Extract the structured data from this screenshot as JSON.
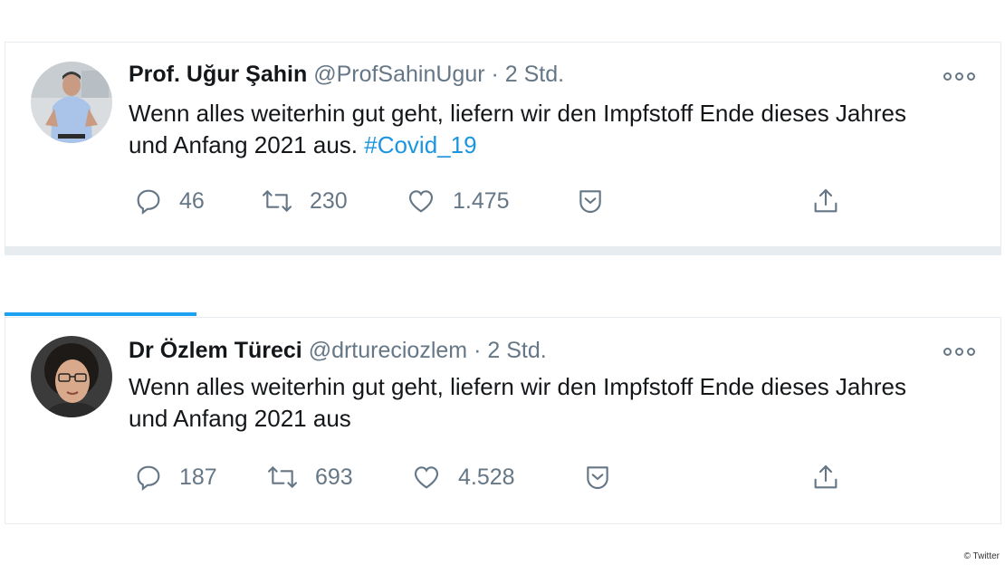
{
  "tweets": [
    {
      "name": "Prof. Uğur Şahin",
      "handle": "@ProfSahinUgur",
      "dot": "·",
      "time": "2 Std.",
      "text": "Wenn alles weiterhin gut geht, liefern wir den Impfstoff Ende dieses Jahres und Anfang 2021 aus. ",
      "hashtag": "#Covid_19",
      "replies": "46",
      "retweets": "230",
      "likes": "1.475"
    },
    {
      "name": "Dr Özlem Türeci",
      "handle": "@drtureciozlem",
      "dot": "·",
      "time": "2 Std.",
      "text": "Wenn alles weiterhin gut geht, liefern wir den Impfstoff Ende dieses Jahres und Anfang 2021 aus",
      "hashtag": "",
      "replies": "187",
      "retweets": "693",
      "likes": "4.528"
    }
  ],
  "credit": "© Twitter",
  "colors": {
    "accent": "#1da1f2",
    "hashtag": "#1b95e0",
    "muted": "#657786",
    "border": "#e6ecf0"
  },
  "icons": [
    "avatar",
    "more-icon",
    "reply-icon",
    "retweet-icon",
    "like-icon",
    "save-icon",
    "share-icon"
  ]
}
